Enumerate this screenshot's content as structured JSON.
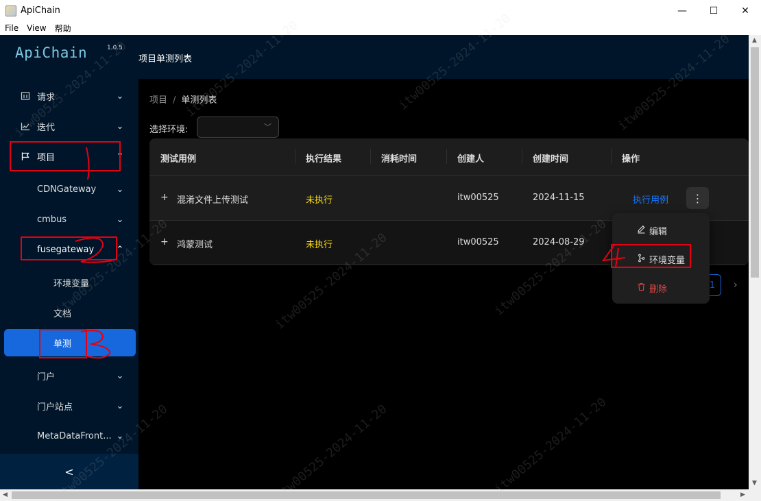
{
  "window": {
    "title": "ApiChain",
    "menu": [
      "File",
      "View",
      "帮助"
    ]
  },
  "sidebar": {
    "logo": "ApiChain",
    "version": "1.0.5",
    "items": [
      {
        "label": "请求",
        "icon": "request-icon"
      },
      {
        "label": "迭代",
        "icon": "chart-icon"
      },
      {
        "label": "项目",
        "icon": "flag-icon"
      },
      {
        "label": "CDNGateway"
      },
      {
        "label": "cmbus"
      },
      {
        "label": "fusegateway"
      },
      {
        "label": "环境变量"
      },
      {
        "label": "文档"
      },
      {
        "label": "单测"
      },
      {
        "label": "门户"
      },
      {
        "label": "门户站点"
      },
      {
        "label": "MetaDataFront..."
      }
    ],
    "collapse": "<"
  },
  "header": {
    "title": "项目单测列表"
  },
  "main": {
    "breadcrumb": [
      "项目",
      "/",
      "单测列表"
    ],
    "env_label": "选择环境:",
    "env_value": "",
    "table": {
      "columns": [
        "测试用例",
        "执行结果",
        "消耗时间",
        "创建人",
        "创建时间",
        "操作"
      ],
      "rows": [
        {
          "name": "混淆文件上传测试",
          "result": "未执行",
          "duration": "",
          "creator": "itw00525",
          "created": "2024-11-15",
          "action": "执行用例"
        },
        {
          "name": "鸿蒙测试",
          "result": "未执行",
          "duration": "",
          "creator": "itw00525",
          "created": "2024-08-29",
          "action": ""
        }
      ]
    },
    "dropdown": [
      "编辑",
      "环境变量",
      "删除"
    ],
    "pager": {
      "current": "1"
    }
  },
  "annotations": [
    "1",
    "2",
    "3",
    "4"
  ],
  "watermark": "itw00525-2024-11-20",
  "colors": {
    "sidebar": "#001529",
    "selected": "#1668dc",
    "link": "#1677ff",
    "warning": "#fadb14",
    "danger": "#dc4446",
    "annotation": "#e60012"
  }
}
